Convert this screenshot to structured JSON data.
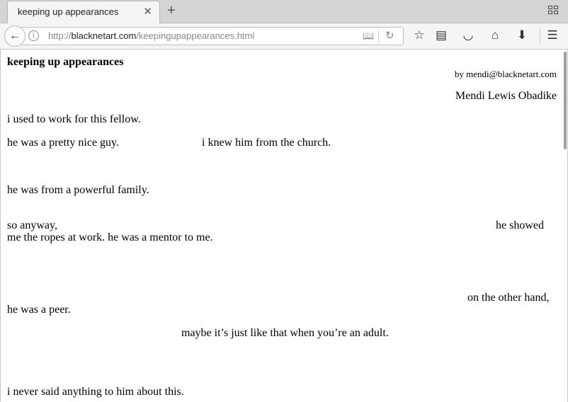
{
  "browser": {
    "tab_title": "keeping up appearances",
    "tab_close": "✕",
    "new_tab": "+",
    "url_prefix": "http://",
    "url_host": "blacknetart.com",
    "url_path": "/keepingupappearances.html"
  },
  "icons": {
    "back": "back-arrow-icon",
    "info": "info-icon",
    "reader": "reader-view-icon",
    "reload": "reload-icon",
    "bookmark": "star-icon",
    "reading_list": "clipboard-icon",
    "pocket": "pocket-icon",
    "home": "home-icon",
    "download": "download-icon",
    "menu": "hamburger-menu-icon",
    "tabs_list": "tab-list-icon"
  },
  "page": {
    "title": "keeping up appearances",
    "byline": "by mendi@blacknetart.com",
    "author": "Mendi Lewis Obadike",
    "lines": {
      "l1": "i used to work for this fellow.",
      "l2a": "he was a pretty nice guy.",
      "l2b": "i knew him from the church.",
      "l3": "he was from a powerful family.",
      "l4a": "so anyway,",
      "l4b": "he showed",
      "l4c": "me the ropes at work. he was a mentor to me.",
      "l5a": "on the other hand,",
      "l5b": "he was a peer.",
      "l6": "maybe it’s just like that when you’re an adult.",
      "l7": "i never said anything to him about this."
    }
  }
}
